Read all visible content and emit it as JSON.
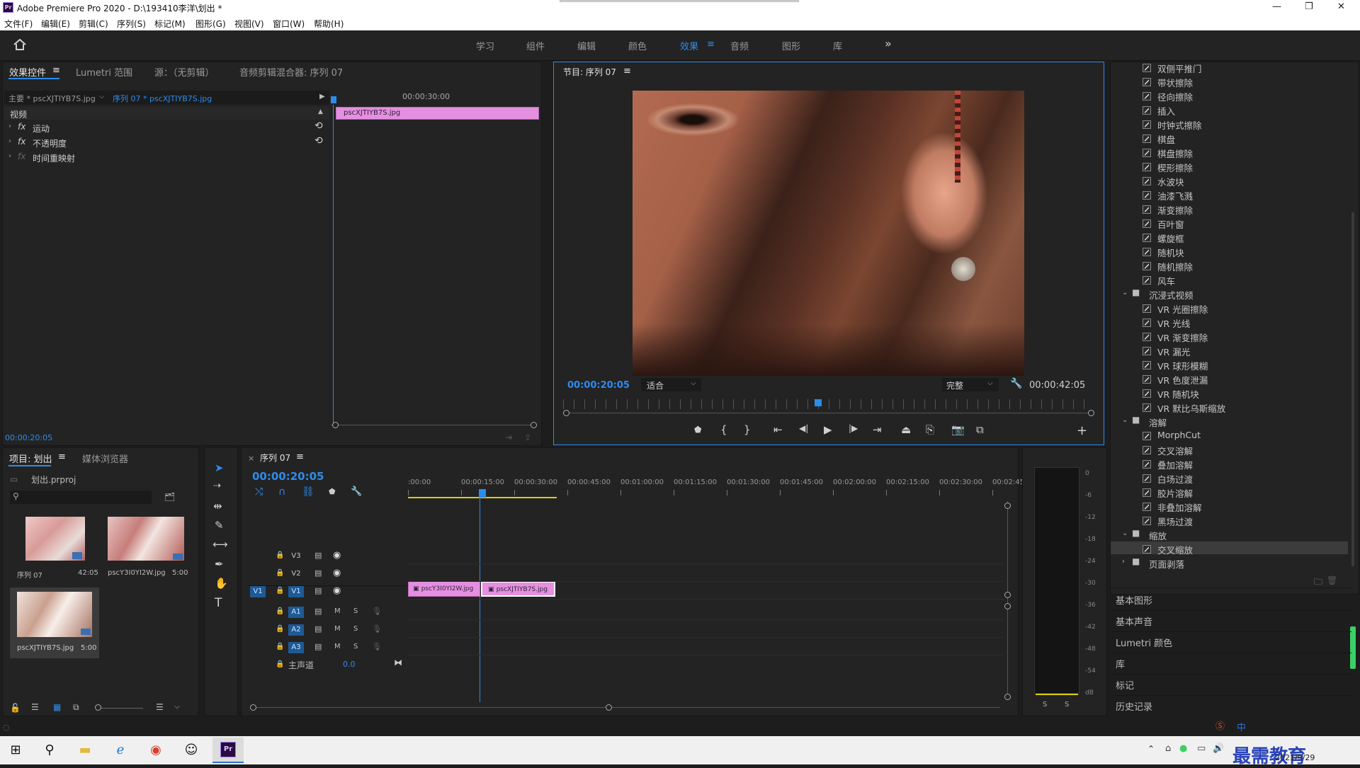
{
  "window": {
    "title": "Adobe Premiere Pro 2020 - D:\\193410李洋\\划出 *",
    "app_badge": "Pr",
    "minimize": "—",
    "maximize": "❐",
    "close": "✕"
  },
  "menu": [
    "文件(F)",
    "编辑(E)",
    "剪辑(C)",
    "序列(S)",
    "标记(M)",
    "图形(G)",
    "视图(V)",
    "窗口(W)",
    "帮助(H)"
  ],
  "workspaces": {
    "items": [
      "学习",
      "组件",
      "编辑",
      "颜色",
      "效果",
      "音频",
      "图形",
      "库"
    ],
    "active": "效果",
    "menu_glyph": "≡",
    "more": "»"
  },
  "effect_controls": {
    "tabs": [
      "效果控件",
      "Lumetri 范围",
      "源：（无剪辑）",
      "音频剪辑混合器: 序列 07"
    ],
    "menu_glyph": "≡",
    "master": "主要 * pscXJTIYB7S.jpg",
    "sequence_clip": "序列 07 * pscXJTIYB7S.jpg",
    "ruler_time": "00:00:30:00",
    "clip_name": "pscXJTIYB7S.jpg",
    "section": "视频",
    "fx_label": "fx",
    "properties": [
      "运动",
      "不透明度",
      "时间重映射"
    ],
    "timecode": "00:00:20:05"
  },
  "program_monitor": {
    "title": "节目: 序列 07",
    "menu_glyph": "≡",
    "timecode": "00:00:20:05",
    "fit": "适合",
    "quality": "完整",
    "duration": "00:00:42:05",
    "playhead_fraction": 0.48
  },
  "project": {
    "tabs": [
      "项目: 划出",
      "媒体浏览器"
    ],
    "menu_glyph": "≡",
    "file": "划出.prproj",
    "items": [
      {
        "name": "序列 07",
        "dur": "42:05"
      },
      {
        "name": "pscY3I0YI2W.jpg",
        "dur": "5:00"
      },
      {
        "name": "pscXJTIYB7S.jpg",
        "dur": "5:00"
      }
    ]
  },
  "timeline": {
    "tab": "序列 07",
    "close": "×",
    "menu_glyph": "≡",
    "timecode": "00:00:20:05",
    "ruler": [
      ":00:00",
      "00:00:15:00",
      "00:00:30:00",
      "00:00:45:00",
      "00:01:00:00",
      "00:01:15:00",
      "00:01:30:00",
      "00:01:45:00",
      "00:02:00:00",
      "00:02:15:00",
      "00:02:30:00",
      "00:02:45:"
    ],
    "video_tracks": [
      "V3",
      "V2",
      "V1"
    ],
    "audio_tracks": [
      "A1",
      "A2",
      "A3"
    ],
    "source_patch": "V1",
    "mute": "M",
    "solo": "S",
    "master": "主声道",
    "master_value": "0.0",
    "clips": [
      "pscY3I0YI2W.jpg",
      "pscXJTIYB7S.jpg"
    ]
  },
  "audio_meter": {
    "scale": [
      "0",
      "-6",
      "-12",
      "-18",
      "-24",
      "-30",
      "-36",
      "-42",
      "-48",
      "-54",
      "dB"
    ],
    "solo_labels": [
      "S",
      "S"
    ]
  },
  "effects": {
    "wipes": [
      "双侧平推门",
      "带状擦除",
      "径向擦除",
      "插入",
      "时钟式擦除",
      "棋盘",
      "棋盘擦除",
      "楔形擦除",
      "水波块",
      "油漆飞溅",
      "渐变擦除",
      "百叶窗",
      "螺旋框",
      "随机块",
      "随机擦除",
      "风车"
    ],
    "vr_folder": "沉浸式视频",
    "vr": [
      "VR 光圈擦除",
      "VR 光线",
      "VR 渐变擦除",
      "VR 漏光",
      "VR 球形模糊",
      "VR 色度泄漏",
      "VR 随机块",
      "VR 默比乌斯缩放"
    ],
    "dissolve_folder": "溶解",
    "dissolve": [
      "MorphCut",
      "交叉溶解",
      "叠加溶解",
      "白场过渡",
      "胶片溶解",
      "非叠加溶解",
      "黑场过渡"
    ],
    "zoom_folder": "缩放",
    "zoom": [
      "交叉缩放"
    ],
    "page_folder": "页面剥落",
    "side_panels": [
      "基本图形",
      "基本声音",
      "Lumetri 颜色",
      "库",
      "标记",
      "历史记录"
    ]
  },
  "tray": {
    "ime": "中",
    "watermark": "最需教育",
    "date": "2021/9/29"
  },
  "colors": {
    "accent": "#2d8ceb",
    "clip": "#e58fe0",
    "panel": "#232323"
  }
}
